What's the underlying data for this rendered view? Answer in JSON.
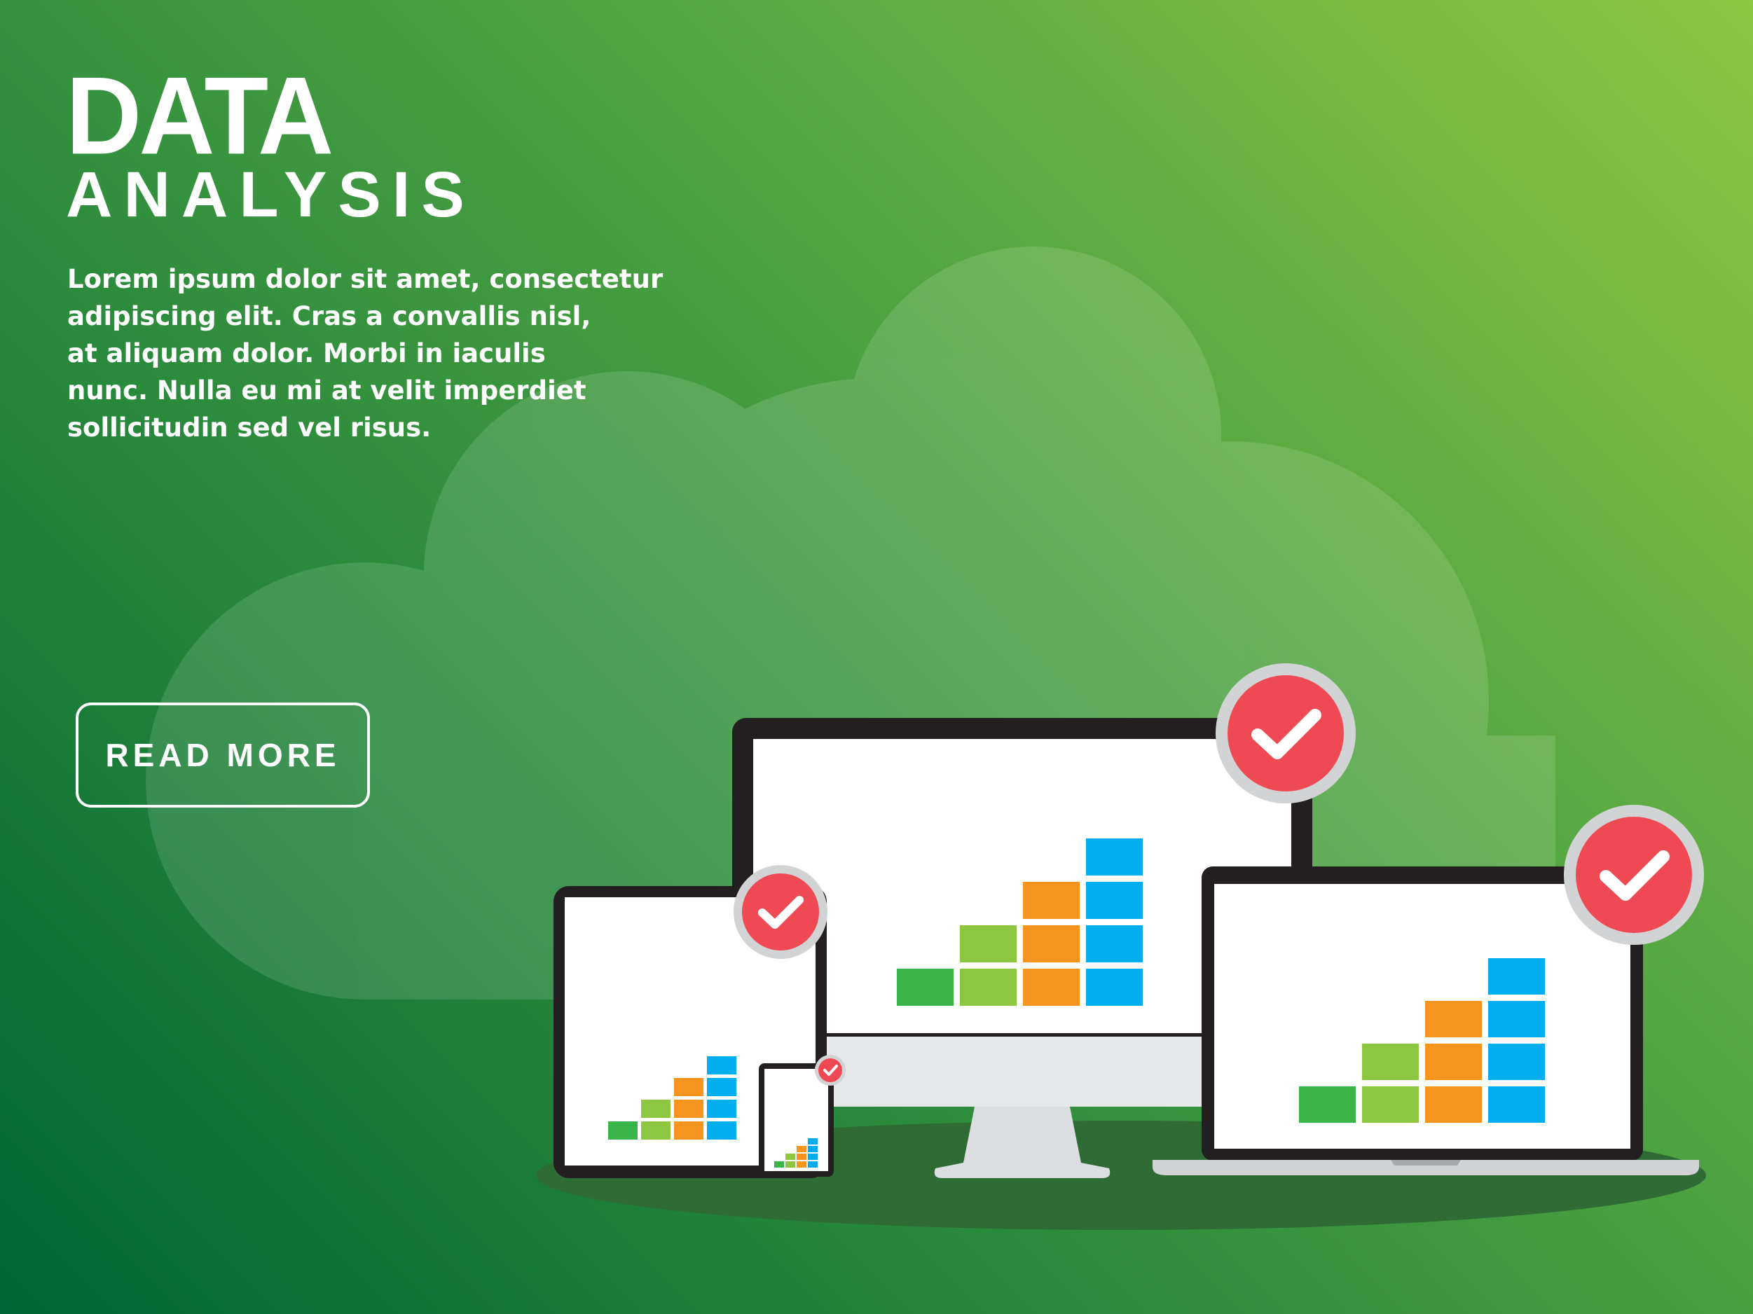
{
  "hero": {
    "title_line1": "DATA",
    "title_line2": "ANALYSIS",
    "body_lines": [
      "Lorem ipsum dolor sit amet, consectetur",
      "adipiscing elit. Cras a convallis nisl,",
      "at aliquam dolor. Morbi in iaculis",
      "nunc. Nulla eu mi at velit imperdiet",
      "sollicitudin sed vel risus."
    ],
    "button_label": "READ MORE"
  },
  "colors": {
    "background_start": "#006633",
    "background_end": "#8dc63f",
    "bar_green": "#39b54a",
    "bar_lime": "#8dc63f",
    "bar_orange": "#f7941d",
    "bar_blue": "#00aeef",
    "check_badge": "#ef4a54",
    "device_frame": "#231f20"
  },
  "icons": [
    "cloud-icon",
    "monitor-icon",
    "tablet-icon",
    "laptop-icon",
    "phone-icon",
    "checkmark-icon"
  ],
  "chart_data": {
    "type": "bar",
    "stacked": true,
    "categories": [
      "1",
      "2",
      "3",
      "4"
    ],
    "values": [
      1,
      2,
      3,
      4
    ],
    "series_colors": [
      "#39b54a",
      "#8dc63f",
      "#f7941d",
      "#00aeef"
    ]
  }
}
